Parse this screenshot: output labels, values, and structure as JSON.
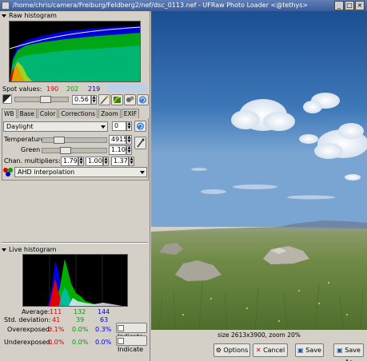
{
  "window": {
    "title": "/home/chris/camera/Freiburg/Feldberg2/nef/dsc_0113.nef - UFRaw Photo Loader <@tethys>"
  },
  "raw_histogram": {
    "label": "Raw histogram",
    "spot_label": "Spot values:",
    "spot_r": "190",
    "spot_g": "202",
    "spot_b": "219"
  },
  "exposure": {
    "value": "0.56"
  },
  "tabs": [
    {
      "label": "WB"
    },
    {
      "label": "Base"
    },
    {
      "label": "Color"
    },
    {
      "label": "Corrections"
    },
    {
      "label": "Zoom"
    },
    {
      "label": "EXIF"
    }
  ],
  "white_balance": {
    "preset": "Daylight",
    "fine_tune": "0",
    "temperature_label": "Temperature",
    "temperature_value": "4915",
    "green_label": "Green",
    "green_value": "1.100",
    "chan_label": "Chan. multipliers:",
    "chan_r": "1.793",
    "chan_g": "1.000",
    "chan_b": "1.371"
  },
  "interpolation": {
    "value": "AHD interpolation"
  },
  "live_histogram": {
    "label": "Live histogram",
    "average_label": "Average:",
    "avg_r": "111",
    "avg_g": "132",
    "avg_b": "144",
    "std_label": "Std. deviation:",
    "std_r": "41",
    "std_g": "39",
    "std_b": "63",
    "over_label": "Overexposed:",
    "over_r": "0.1%",
    "over_g": "0.0%",
    "over_b": "0.3%",
    "under_label": "Underexposed:",
    "under_r": "0.0%",
    "under_g": "0.0%",
    "under_b": "0.0%",
    "indicate_label": "Indicate"
  },
  "preview": {
    "status": "size 2613x3900, zoom 20%"
  },
  "buttons": {
    "options": "Options",
    "cancel": "Cancel",
    "save": "Save",
    "save_as": "Save As"
  },
  "colors": {
    "red": "#e00000",
    "green": "#00a000",
    "blue": "#0000e0",
    "title_bar": "#4a6ca8"
  }
}
